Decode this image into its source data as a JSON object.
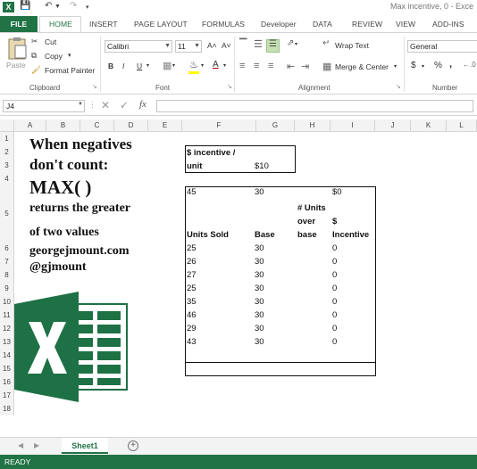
{
  "window": {
    "title": "Max incentive, 0 - Exce",
    "app_icon": "X"
  },
  "tabs": [
    "FILE",
    "HOME",
    "INSERT",
    "PAGE LAYOUT",
    "FORMULAS",
    "Developer",
    "DATA",
    "REVIEW",
    "VIEW",
    "ADD-INS"
  ],
  "ribbon": {
    "clipboard": {
      "paste": "Paste",
      "cut": "Cut",
      "copy": "Copy",
      "format_painter": "Format Painter",
      "label": "Clipboard"
    },
    "font": {
      "name": "Calibri",
      "size": "11",
      "label": "Font",
      "bold": "B",
      "italic": "I",
      "underline": "U",
      "grow": "A˄",
      "shrink": "A˅"
    },
    "alignment": {
      "wrap_text": "Wrap Text",
      "merge_center": "Merge & Center",
      "label": "Alignment"
    },
    "number": {
      "format": "General",
      "currency": "$",
      "percent": "%",
      "comma": ",",
      "label": "Number"
    }
  },
  "formula_bar": {
    "name_box": "J4",
    "fx": "fx",
    "value": ""
  },
  "columns": [
    "A",
    "B",
    "C",
    "D",
    "E",
    "F",
    "G",
    "H",
    "I",
    "J",
    "K",
    "L"
  ],
  "rows": [
    "1",
    "2",
    "3",
    "4",
    "5",
    "6",
    "7",
    "8",
    "9",
    "10",
    "11",
    "12",
    "13",
    "14",
    "15",
    "16",
    "17",
    "18"
  ],
  "sheet_text": {
    "line1": "When negatives",
    "line2": "don't count:",
    "line3": "MAX( )",
    "line4": "returns the greater",
    "line5": "of two values",
    "line6": "georgejmount.com",
    "line7": "@gjmount"
  },
  "incentive_box": {
    "label_line1": "$ incentive /",
    "label_line2": "unit",
    "value": "$10"
  },
  "table": {
    "headers": {
      "units_sold": "Units Sold",
      "base": "Base",
      "units_over_base_l1": "# Units",
      "units_over_base_l2": "over",
      "units_over_base_l3": "base",
      "incentive_l1": "$",
      "incentive_l2": "Incentive"
    },
    "rows": [
      {
        "units": "45",
        "base": "30",
        "incentive": "$0"
      },
      {
        "units": "25",
        "base": "30",
        "incentive": "0"
      },
      {
        "units": "26",
        "base": "30",
        "incentive": "0"
      },
      {
        "units": "27",
        "base": "30",
        "incentive": "0"
      },
      {
        "units": "25",
        "base": "30",
        "incentive": "0"
      },
      {
        "units": "35",
        "base": "30",
        "incentive": "0"
      },
      {
        "units": "46",
        "base": "30",
        "incentive": "0"
      },
      {
        "units": "29",
        "base": "30",
        "incentive": "0"
      },
      {
        "units": "43",
        "base": "30",
        "incentive": "0"
      }
    ]
  },
  "sheet_tabs": {
    "active": "Sheet1"
  },
  "status": "READY",
  "colors": {
    "excel_green": "#217346",
    "logo_dark": "#1e7145",
    "logo_light": "#ffffff"
  }
}
